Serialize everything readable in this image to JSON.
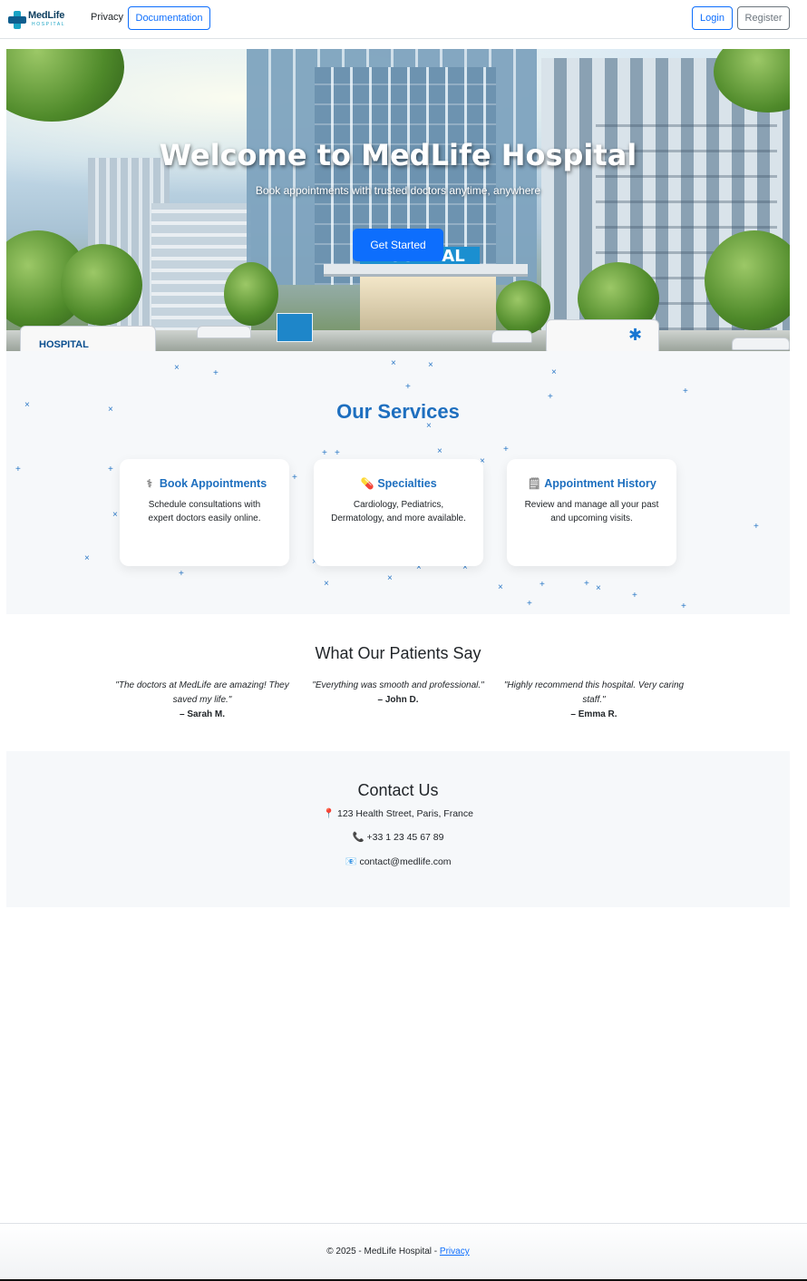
{
  "navbar": {
    "brand_name": "MedLife",
    "brand_sub": "HOSPITAL",
    "privacy": "Privacy",
    "documentation": "Documentation",
    "login": "Login",
    "register": "Register"
  },
  "hero": {
    "title": "Welcome to MedLife Hospital",
    "subtitle": "Book appointments with trusted doctors anytime, anywhere",
    "cta": "Get Started",
    "sign_text": "HOSPITAL",
    "van_text": "HOSPITAL"
  },
  "services": {
    "title": "Our Services",
    "cards": [
      {
        "icon": "stethoscope-icon",
        "glyph": "⚕",
        "title": "Book Appointments",
        "text": "Schedule consultations with expert doctors easily online."
      },
      {
        "icon": "pill-icon",
        "glyph": "💊",
        "title": "Specialties",
        "text": "Cardiology, Pediatrics, Dermatology, and more available."
      },
      {
        "icon": "clipboard-icon",
        "glyph": "🗒",
        "title": "Appointment History",
        "text": "Review and manage all your past and upcoming visits."
      }
    ]
  },
  "testimonials": {
    "title": "What Our Patients Say",
    "items": [
      {
        "quote": "\"The doctors at MedLife are amazing! They saved my life.\"",
        "author": "– Sarah M."
      },
      {
        "quote": "\"Everything was smooth and professional.\"",
        "author": "– John D."
      },
      {
        "quote": "\"Highly recommend this hospital. Very caring staff.\"",
        "author": "– Emma R."
      }
    ]
  },
  "contact": {
    "title": "Contact Us",
    "address": "123 Health Street, Paris, France",
    "phone": "+33 1 23 45 67 89",
    "email": "contact@medlife.com"
  },
  "footer": {
    "text": "© 2025 - MedLife Hospital - ",
    "privacy_link": "Privacy"
  },
  "colors": {
    "primary": "#0d6efd",
    "accent_blue": "#1e6fbf",
    "section_bg": "#f6f8fa"
  }
}
